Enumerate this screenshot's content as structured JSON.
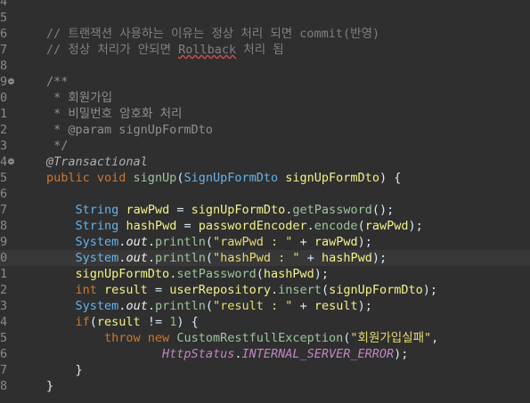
{
  "editor": {
    "lines": [
      {
        "number": "4",
        "fold": false,
        "current": false,
        "segments": []
      },
      {
        "number": "5",
        "fold": false,
        "current": false,
        "segments": []
      },
      {
        "number": "6",
        "fold": false,
        "current": false,
        "segments": [
          {
            "text": "// 트랜잭션 사용하는 이유는 정상 처리 되면 commit(반영)",
            "kind": "comment"
          }
        ]
      },
      {
        "number": "7",
        "fold": false,
        "current": false,
        "segments": [
          {
            "text": "// 정상 처리가 안되면 ",
            "kind": "comment"
          },
          {
            "text": "Rollback",
            "kind": "comment-underline"
          },
          {
            "text": " 처리 됨",
            "kind": "comment"
          }
        ]
      },
      {
        "number": "8",
        "fold": false,
        "current": false,
        "segments": []
      },
      {
        "number": "9",
        "fold": true,
        "current": false,
        "segments": [
          {
            "text": "/**",
            "kind": "doc"
          }
        ]
      },
      {
        "number": "0",
        "fold": false,
        "current": false,
        "segments": [
          {
            "text": " * 회원가입",
            "kind": "doc"
          }
        ]
      },
      {
        "number": "1",
        "fold": false,
        "current": false,
        "segments": [
          {
            "text": " * 비밀번호 암호화 처리",
            "kind": "doc"
          }
        ]
      },
      {
        "number": "2",
        "fold": false,
        "current": false,
        "segments": [
          {
            "text": " * @param signUpFormDto",
            "kind": "doc"
          }
        ]
      },
      {
        "number": "3",
        "fold": false,
        "current": false,
        "segments": [
          {
            "text": " */",
            "kind": "doc"
          }
        ]
      },
      {
        "number": "4",
        "fold": true,
        "current": false,
        "segments": [
          {
            "text": "@Transactional",
            "kind": "annotation"
          }
        ]
      },
      {
        "number": "5",
        "fold": false,
        "current": false,
        "segments": [
          {
            "text": "public void ",
            "kind": "keyword"
          },
          {
            "text": "signUp",
            "kind": "method"
          },
          {
            "text": "(",
            "kind": "plain"
          },
          {
            "text": "SignUpFormDto",
            "kind": "type"
          },
          {
            "text": " ",
            "kind": "plain"
          },
          {
            "text": "signUpFormDto",
            "kind": "var"
          },
          {
            "text": ") {",
            "kind": "plain"
          }
        ]
      },
      {
        "number": "6",
        "fold": false,
        "current": false,
        "segments": []
      },
      {
        "number": "7",
        "fold": false,
        "current": false,
        "segments": [
          {
            "text": "    ",
            "kind": "plain"
          },
          {
            "text": "String",
            "kind": "type"
          },
          {
            "text": " ",
            "kind": "plain"
          },
          {
            "text": "rawPwd",
            "kind": "var"
          },
          {
            "text": " = ",
            "kind": "plain"
          },
          {
            "text": "signUpFormDto",
            "kind": "var"
          },
          {
            "text": ".",
            "kind": "plain"
          },
          {
            "text": "getPassword",
            "kind": "method"
          },
          {
            "text": "();",
            "kind": "plain"
          }
        ]
      },
      {
        "number": "8",
        "fold": false,
        "current": false,
        "segments": [
          {
            "text": "    ",
            "kind": "plain"
          },
          {
            "text": "String",
            "kind": "type"
          },
          {
            "text": " ",
            "kind": "plain"
          },
          {
            "text": "hashPwd",
            "kind": "var"
          },
          {
            "text": " = ",
            "kind": "plain"
          },
          {
            "text": "passwordEncoder",
            "kind": "var"
          },
          {
            "text": ".",
            "kind": "plain"
          },
          {
            "text": "encode",
            "kind": "method"
          },
          {
            "text": "(",
            "kind": "plain"
          },
          {
            "text": "rawPwd",
            "kind": "var"
          },
          {
            "text": ");",
            "kind": "plain"
          }
        ]
      },
      {
        "number": "9",
        "fold": false,
        "current": false,
        "segments": [
          {
            "text": "    ",
            "kind": "plain"
          },
          {
            "text": "System",
            "kind": "type"
          },
          {
            "text": ".",
            "kind": "plain"
          },
          {
            "text": "out",
            "kind": "out"
          },
          {
            "text": ".",
            "kind": "plain"
          },
          {
            "text": "println",
            "kind": "method"
          },
          {
            "text": "(",
            "kind": "plain"
          },
          {
            "text": "\"rawPwd : \"",
            "kind": "string"
          },
          {
            "text": " + ",
            "kind": "plain"
          },
          {
            "text": "rawPwd",
            "kind": "var"
          },
          {
            "text": ");",
            "kind": "plain"
          }
        ]
      },
      {
        "number": "0",
        "fold": false,
        "current": true,
        "segments": [
          {
            "text": "    ",
            "kind": "plain"
          },
          {
            "text": "System",
            "kind": "type"
          },
          {
            "text": ".",
            "kind": "plain"
          },
          {
            "text": "out",
            "kind": "out"
          },
          {
            "text": ".",
            "kind": "plain"
          },
          {
            "text": "println",
            "kind": "method"
          },
          {
            "text": "(",
            "kind": "plain"
          },
          {
            "text": "\"hashPwd : \"",
            "kind": "string"
          },
          {
            "text": " + ",
            "kind": "plain"
          },
          {
            "text": "hashPwd",
            "kind": "var"
          },
          {
            "text": ");",
            "kind": "plain"
          }
        ]
      },
      {
        "number": "1",
        "fold": false,
        "current": false,
        "segments": [
          {
            "text": "    ",
            "kind": "plain"
          },
          {
            "text": "signUpFormDto",
            "kind": "var"
          },
          {
            "text": ".",
            "kind": "plain"
          },
          {
            "text": "setPassword",
            "kind": "method"
          },
          {
            "text": "(",
            "kind": "plain"
          },
          {
            "text": "hashPwd",
            "kind": "var"
          },
          {
            "text": ");",
            "kind": "plain"
          }
        ]
      },
      {
        "number": "2",
        "fold": false,
        "current": false,
        "segments": [
          {
            "text": "    ",
            "kind": "plain"
          },
          {
            "text": "int",
            "kind": "keyword"
          },
          {
            "text": " ",
            "kind": "plain"
          },
          {
            "text": "result",
            "kind": "var"
          },
          {
            "text": " = ",
            "kind": "plain"
          },
          {
            "text": "userRepository",
            "kind": "var"
          },
          {
            "text": ".",
            "kind": "plain"
          },
          {
            "text": "insert",
            "kind": "method"
          },
          {
            "text": "(",
            "kind": "plain"
          },
          {
            "text": "signUpFormDto",
            "kind": "var"
          },
          {
            "text": ");",
            "kind": "plain"
          }
        ]
      },
      {
        "number": "3",
        "fold": false,
        "current": false,
        "segments": [
          {
            "text": "    ",
            "kind": "plain"
          },
          {
            "text": "System",
            "kind": "type"
          },
          {
            "text": ".",
            "kind": "plain"
          },
          {
            "text": "out",
            "kind": "out"
          },
          {
            "text": ".",
            "kind": "plain"
          },
          {
            "text": "println",
            "kind": "method"
          },
          {
            "text": "(",
            "kind": "plain"
          },
          {
            "text": "\"result : \"",
            "kind": "string"
          },
          {
            "text": " + ",
            "kind": "plain"
          },
          {
            "text": "result",
            "kind": "var"
          },
          {
            "text": ");",
            "kind": "plain"
          }
        ]
      },
      {
        "number": "4",
        "fold": false,
        "current": false,
        "segments": [
          {
            "text": "    ",
            "kind": "plain"
          },
          {
            "text": "if",
            "kind": "keyword"
          },
          {
            "text": "(",
            "kind": "plain"
          },
          {
            "text": "result",
            "kind": "var"
          },
          {
            "text": " != ",
            "kind": "plain"
          },
          {
            "text": "1",
            "kind": "number"
          },
          {
            "text": ") {",
            "kind": "plain"
          }
        ]
      },
      {
        "number": "5",
        "fold": false,
        "current": false,
        "segments": [
          {
            "text": "        ",
            "kind": "plain"
          },
          {
            "text": "throw new ",
            "kind": "keyword"
          },
          {
            "text": "CustomRestfullException",
            "kind": "method"
          },
          {
            "text": "(",
            "kind": "plain"
          },
          {
            "text": "\"회원가입실패\"",
            "kind": "string"
          },
          {
            "text": ",",
            "kind": "plain"
          }
        ]
      },
      {
        "number": "6",
        "fold": false,
        "current": false,
        "segments": [
          {
            "text": "                ",
            "kind": "plain"
          },
          {
            "text": "HttpStatus",
            "kind": "field"
          },
          {
            "text": ".",
            "kind": "plain"
          },
          {
            "text": "INTERNAL_SERVER_ERROR",
            "kind": "field"
          },
          {
            "text": ");",
            "kind": "plain"
          }
        ]
      },
      {
        "number": "7",
        "fold": false,
        "current": false,
        "segments": [
          {
            "text": "    }",
            "kind": "plain"
          }
        ]
      },
      {
        "number": "8",
        "fold": false,
        "current": false,
        "segments": [
          {
            "text": "}",
            "kind": "plain"
          }
        ]
      }
    ]
  }
}
